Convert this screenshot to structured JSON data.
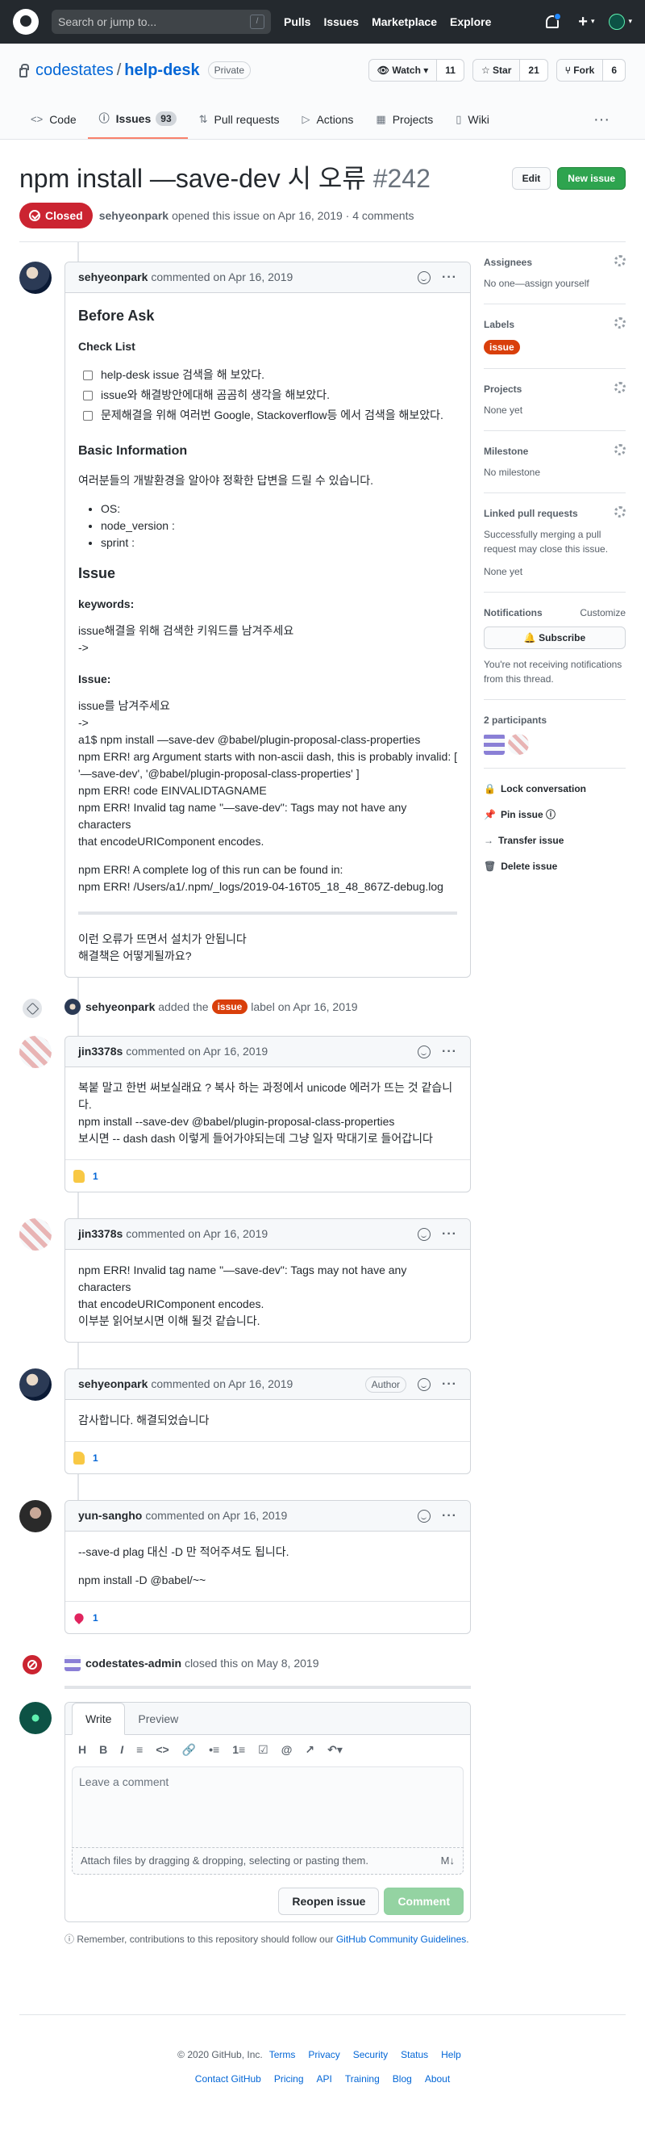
{
  "header": {
    "search_placeholder": "Search or jump to...",
    "search_key": "/",
    "nav": [
      "Pulls",
      "Issues",
      "Marketplace",
      "Explore"
    ],
    "plus": "+",
    "caret": "▾"
  },
  "repo": {
    "owner": "codestates",
    "sep": "/",
    "name": "help-desk",
    "visibility": "Private",
    "watch": "Watch",
    "watch_count": "11",
    "star": "Star",
    "star_count": "21",
    "fork": "Fork",
    "fork_count": "6"
  },
  "tabs": [
    {
      "label": "Code",
      "icon": "<>"
    },
    {
      "label": "Issues",
      "icon": "ⓘ",
      "count": "93"
    },
    {
      "label": "Pull requests",
      "icon": "⇅"
    },
    {
      "label": "Actions",
      "icon": "▷"
    },
    {
      "label": "Projects",
      "icon": "▦"
    },
    {
      "label": "Wiki",
      "icon": "▯"
    }
  ],
  "tabs_more": "···",
  "issue": {
    "title": "npm install —save-dev 시 오류",
    "number": "#242",
    "edit": "Edit",
    "new_issue": "New issue",
    "status": "Closed",
    "author": "sehyeonpark",
    "meta": "opened this issue on Apr 16, 2019 · 4 comments"
  },
  "first": {
    "author": "sehyeonpark",
    "when": "commented on Apr 16, 2019",
    "h_before": "Before Ask",
    "h_check": "Check List",
    "checks": [
      "help-desk issue 검색을 해 보았다.",
      "issue와 해결방안에대해 곰곰히 생각을 해보았다.",
      "문제해결을 위해 여러번 Google, Stackoverflow등 에서 검색을 해보았다."
    ],
    "h_basic": "Basic Information",
    "basic_desc": "여러분들의 개발환경을 알아야 정확한 답변을 드릴 수 있습니다.",
    "env": [
      "OS:",
      "node_version :",
      "sprint :"
    ],
    "h_issue": "Issue",
    "kw_label": "keywords:",
    "kw_text1": "issue해결을 위해 검색한 키워드를 남겨주세요",
    "kw_text2": "->",
    "iss_label": "Issue:",
    "lines": [
      "issue를 남겨주세요",
      "->",
      "a1$ npm install —save-dev @babel/plugin-proposal-class-properties",
      "npm ERR! arg Argument starts with non-ascii dash, this is probably invalid: [",
      "'—save-dev', '@babel/plugin-proposal-class-properties' ]",
      "npm ERR! code EINVALIDTAGNAME",
      "npm ERR! Invalid tag name \"—save-dev\": Tags may not have any characters",
      "that encodeURIComponent encodes."
    ],
    "log1": "npm ERR! A complete log of this run can be found in:",
    "log2": "npm ERR! /Users/a1/.npm/_logs/2019-04-16T05_18_48_867Z-debug.log",
    "end1": "이런 오류가 뜨면서 설치가 안됩니다",
    "end2": "해결책은 어떻게될까요?"
  },
  "label_event": {
    "actor": "sehyeonpark",
    "pre": "added the",
    "label": "issue",
    "post": "label on Apr 16, 2019"
  },
  "comments": [
    {
      "author": "jin3378s",
      "when": "commented on Apr 16, 2019",
      "lines": [
        "복붙 말고 한번 써보실래요 ? 복사 하는 과정에서 unicode 에러가 뜨는 것 같습니다.",
        "npm install --save-dev @babel/plugin-proposal-class-properties",
        "보시면 -- dash dash 이렇게 들어가야되는데 그냥 일자 막대기로 들어갑니다"
      ],
      "reaction": "1"
    },
    {
      "author": "jin3378s",
      "when": "commented on Apr 16, 2019",
      "lines": [
        "npm ERR! Invalid tag name \"—save-dev\": Tags may not have any characters",
        "that encodeURIComponent encodes.",
        "이부분 읽어보시면 이해 될것 같습니다."
      ]
    },
    {
      "author": "sehyeonpark",
      "when": "commented on Apr 16, 2019",
      "badge": "Author",
      "lines": [
        "감사합니다. 해결되었습니다"
      ],
      "reaction": "1"
    },
    {
      "author": "yun-sangho",
      "when": "commented on Apr 16, 2019",
      "line1": "--save-d plag 대신 -D 만 적어주셔도 됩니다.",
      "line2": "npm install -D @babel/~~",
      "reaction": "1"
    }
  ],
  "close_event": {
    "actor": "codestates-admin",
    "text": "closed this on May 8, 2019"
  },
  "new_comment": {
    "write": "Write",
    "preview": "Preview",
    "toolbar": [
      "H",
      "B",
      "I",
      "≡",
      "<>",
      "🔗",
      "•≡",
      "1≡",
      "☑",
      "@",
      "↗",
      "↶▾"
    ],
    "placeholder": "Leave a comment",
    "attach": "Attach files by dragging & dropping, selecting or pasting them.",
    "md": "M↓",
    "reopen": "Reopen issue",
    "comment": "Comment"
  },
  "remember": {
    "text": "Remember, contributions to this repository should follow our ",
    "link": "GitHub Community Guidelines",
    "end": "."
  },
  "sidebar": {
    "assignees": "Assignees",
    "assignees_v": "No one—assign yourself",
    "labels": "Labels",
    "label": "issue",
    "projects": "Projects",
    "projects_v": "None yet",
    "milestone": "Milestone",
    "milestone_v": "No milestone",
    "linked": "Linked pull requests",
    "linked_desc": "Successfully merging a pull request may close this issue.",
    "linked_v": "None yet",
    "notif": "Notifications",
    "customize": "Customize",
    "subscribe": "Subscribe",
    "notif_desc": "You're not receiving notifications from this thread.",
    "participants": "2 participants",
    "lock": "Lock conversation",
    "pin": "Pin issue",
    "transfer": "Transfer issue",
    "delete": "Delete issue"
  },
  "footer": {
    "copy": "© 2020 GitHub, Inc.",
    "row1": [
      "Terms",
      "Privacy",
      "Security",
      "Status",
      "Help"
    ],
    "row2": [
      "Contact GitHub",
      "Pricing",
      "API",
      "Training",
      "Blog",
      "About"
    ]
  },
  "colors": {
    "accent": "#0366d6",
    "closed": "#cb2431",
    "label": "#d93f0b",
    "green": "#2ea44f"
  }
}
